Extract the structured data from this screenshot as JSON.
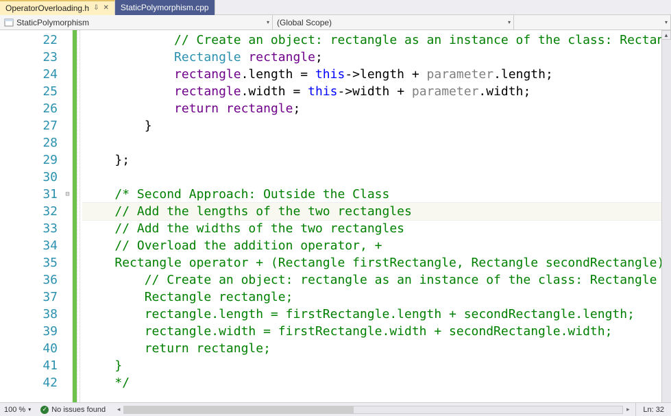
{
  "tabs": {
    "active": {
      "label": "OperatorOverloading.h",
      "pin": "⇩",
      "close": "✕"
    },
    "inactive": {
      "label": "StaticPolymorphism.cpp"
    }
  },
  "nav": {
    "project": "StaticPolymorphism",
    "scope": "(Global Scope)",
    "member": ""
  },
  "line_start": 22,
  "lines": [
    {
      "n": 22,
      "indent": "            ",
      "tokens": [
        [
          "c-comment",
          "// Create an object: rectangle as an instance of the class: Rectangle"
        ]
      ]
    },
    {
      "n": 23,
      "indent": "            ",
      "tokens": [
        [
          "c-type",
          "Rectangle"
        ],
        [
          "c-black",
          " "
        ],
        [
          "c-id",
          "rectangle"
        ],
        [
          "c-black",
          ";"
        ]
      ]
    },
    {
      "n": 24,
      "indent": "            ",
      "tokens": [
        [
          "c-id",
          "rectangle"
        ],
        [
          "c-black",
          ".length = "
        ],
        [
          "c-keyword",
          "this"
        ],
        [
          "c-black",
          "->length + "
        ],
        [
          "c-gray",
          "parameter"
        ],
        [
          "c-black",
          ".length;"
        ]
      ]
    },
    {
      "n": 25,
      "indent": "            ",
      "tokens": [
        [
          "c-id",
          "rectangle"
        ],
        [
          "c-black",
          ".width = "
        ],
        [
          "c-keyword",
          "this"
        ],
        [
          "c-black",
          "->width + "
        ],
        [
          "c-gray",
          "parameter"
        ],
        [
          "c-black",
          ".width;"
        ]
      ]
    },
    {
      "n": 26,
      "indent": "            ",
      "tokens": [
        [
          "c-id",
          "return"
        ],
        [
          "c-black",
          " "
        ],
        [
          "c-id",
          "rectangle"
        ],
        [
          "c-black",
          ";"
        ]
      ]
    },
    {
      "n": 27,
      "indent": "        ",
      "tokens": [
        [
          "c-black",
          "}"
        ]
      ]
    },
    {
      "n": 28,
      "indent": "",
      "tokens": []
    },
    {
      "n": 29,
      "indent": "    ",
      "tokens": [
        [
          "c-black",
          "};"
        ]
      ]
    },
    {
      "n": 30,
      "indent": "",
      "tokens": []
    },
    {
      "n": 31,
      "indent": "    ",
      "fold": "⊟",
      "tokens": [
        [
          "c-comment",
          "/* Second Approach: Outside the Class"
        ]
      ]
    },
    {
      "n": 32,
      "indent": "    ",
      "current": true,
      "tokens": [
        [
          "c-comment",
          "// Add the lengths of the two rectangles"
        ]
      ]
    },
    {
      "n": 33,
      "indent": "    ",
      "tokens": [
        [
          "c-comment",
          "// Add the widths of the two rectangles"
        ]
      ]
    },
    {
      "n": 34,
      "indent": "    ",
      "tokens": [
        [
          "c-comment",
          "// Overload the addition operator, +"
        ]
      ]
    },
    {
      "n": 35,
      "indent": "    ",
      "tokens": [
        [
          "c-comment",
          "Rectangle operator + (Rectangle firstRectangle, Rectangle secondRectangle) {"
        ]
      ]
    },
    {
      "n": 36,
      "indent": "        ",
      "tokens": [
        [
          "c-comment",
          "// Create an object: rectangle as an instance of the class: Rectangle"
        ]
      ]
    },
    {
      "n": 37,
      "indent": "        ",
      "tokens": [
        [
          "c-comment",
          "Rectangle rectangle;"
        ]
      ]
    },
    {
      "n": 38,
      "indent": "        ",
      "tokens": [
        [
          "c-comment",
          "rectangle.length = firstRectangle.length + secondRectangle.length;"
        ]
      ]
    },
    {
      "n": 39,
      "indent": "        ",
      "tokens": [
        [
          "c-comment",
          "rectangle.width = firstRectangle.width + secondRectangle.width;"
        ]
      ]
    },
    {
      "n": 40,
      "indent": "        ",
      "tokens": [
        [
          "c-comment",
          "return rectangle;"
        ]
      ]
    },
    {
      "n": 41,
      "indent": "    ",
      "tokens": [
        [
          "c-comment",
          "}"
        ]
      ]
    },
    {
      "n": 42,
      "indent": "    ",
      "tokens": [
        [
          "c-comment",
          "*/"
        ]
      ]
    }
  ],
  "status": {
    "zoom": "100 %",
    "issues": "No issues found",
    "line_col": "Ln: 32"
  }
}
